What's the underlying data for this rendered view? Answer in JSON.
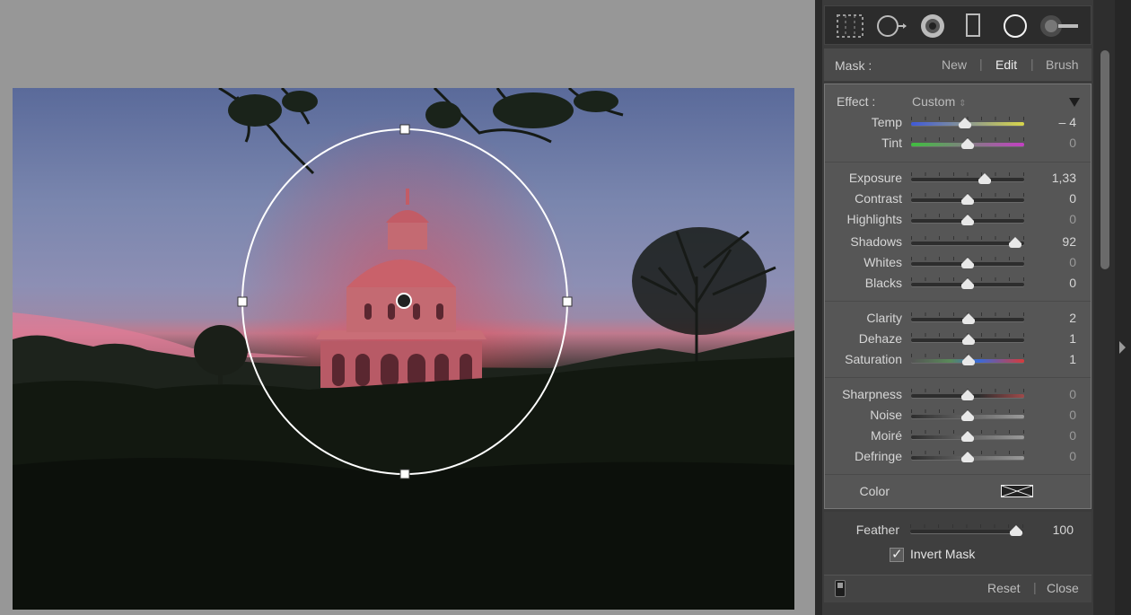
{
  "mask": {
    "label": "Mask :",
    "options": [
      "New",
      "Edit",
      "Brush"
    ],
    "active": "Edit"
  },
  "tools": [
    "crop-overlay-icon",
    "spot-removal-icon",
    "red-eye-icon",
    "graduated-filter-icon",
    "radial-filter-icon",
    "adjustment-brush-icon"
  ],
  "effect": {
    "label": "Effect :",
    "value": "Custom"
  },
  "sliders": {
    "temp": {
      "name": "Temp",
      "value": "– 4",
      "pos": 0.48
    },
    "tint": {
      "name": "Tint",
      "value": "0",
      "pos": 0.5
    },
    "exposure": {
      "name": "Exposure",
      "value": "1,33",
      "pos": 0.65
    },
    "contrast": {
      "name": "Contrast",
      "value": "0",
      "pos": 0.5
    },
    "highlights": {
      "name": "Highlights",
      "value": "0",
      "pos": 0.5
    },
    "shadows": {
      "name": "Shadows",
      "value": "92",
      "pos": 0.92
    },
    "whites": {
      "name": "Whites",
      "value": "0",
      "pos": 0.5
    },
    "blacks": {
      "name": "Blacks",
      "value": "0",
      "pos": 0.5
    },
    "clarity": {
      "name": "Clarity",
      "value": "2",
      "pos": 0.51
    },
    "dehaze": {
      "name": "Dehaze",
      "value": "1",
      "pos": 0.505
    },
    "saturation": {
      "name": "Saturation",
      "value": "1",
      "pos": 0.505
    },
    "sharpness": {
      "name": "Sharpness",
      "value": "0",
      "pos": 0.5
    },
    "noise": {
      "name": "Noise",
      "value": "0",
      "pos": 0.5
    },
    "moire": {
      "name": "Moiré",
      "value": "0",
      "pos": 0.5
    },
    "defringe": {
      "name": "Defringe",
      "value": "0",
      "pos": 0.5
    }
  },
  "color": {
    "label": "Color"
  },
  "feather": {
    "name": "Feather",
    "value": "100",
    "pos": 0.94
  },
  "invert_mask": {
    "label": "Invert Mask",
    "checked": true
  },
  "footer": {
    "reset": "Reset",
    "close": "Close"
  },
  "colors": {
    "panel": "#3b3b3b",
    "effects_bg": "#565656",
    "mask_overlay": "#eb3c46"
  }
}
